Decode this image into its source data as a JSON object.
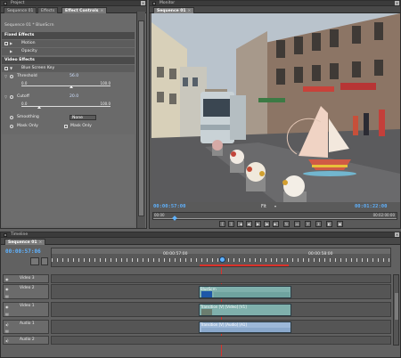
{
  "project_window": {
    "title": "Project",
    "tabs": [
      {
        "label": "Sequence 01"
      },
      {
        "label": "Effects"
      },
      {
        "label": "Effect Controls"
      }
    ]
  },
  "effect_controls": {
    "clip_header": "Sequence 01 * BlueScrn",
    "fixed_effects_label": "Fixed Effects",
    "motion_label": "Motion",
    "opacity_label": "Opacity",
    "video_effects_label": "Video Effects",
    "blue_screen_key_label": "Blue Screen Key",
    "threshold_label": "Threshold",
    "threshold_value": "56.0",
    "threshold_min": "0.0",
    "threshold_max": "100.0",
    "threshold_fraction": 0.56,
    "cutoff_label": "Cutoff",
    "cutoff_value": "20.0",
    "cutoff_min": "0.0",
    "cutoff_max": "100.0",
    "cutoff_fraction": 0.2,
    "smoothing_label": "Smoothing",
    "smoothing_value": "None",
    "mask_only_label": "Mask Only",
    "mask_only_checkbox_label": "Mask Only"
  },
  "monitor_window": {
    "title": "Monitor",
    "tab_label": "Sequence 01",
    "current_time": "00:00:57:00",
    "zoom_label": "Fit",
    "duration": "00:01:22:00",
    "ruler_start": "00:00",
    "ruler_end": "00:02:00:00"
  },
  "timeline_window": {
    "title": "Timeline",
    "tab_label": "Sequence 01",
    "current_time": "00:00:57:06",
    "ruler_mid": "00:00:57:00",
    "ruler_right": "00:00:58:00",
    "tracks": [
      {
        "label": "Video 3"
      },
      {
        "label": "Video 2"
      },
      {
        "label": "Video 1"
      },
      {
        "label": "Audio 1"
      },
      {
        "label": "Audio 2"
      }
    ],
    "clips": {
      "video2_clip_name": "BlueScrn",
      "video1_clip_name": "Transition [V] [Video] [V1]",
      "audio1_clip_name": "Transition [V] [Audio] [A1]"
    }
  },
  "colors": {
    "timecode_blue": "#5fb2ff",
    "clip_teal": "#7fb0ac",
    "clip_blue": "#9db8d8",
    "in_out_red": "#d9322b"
  }
}
